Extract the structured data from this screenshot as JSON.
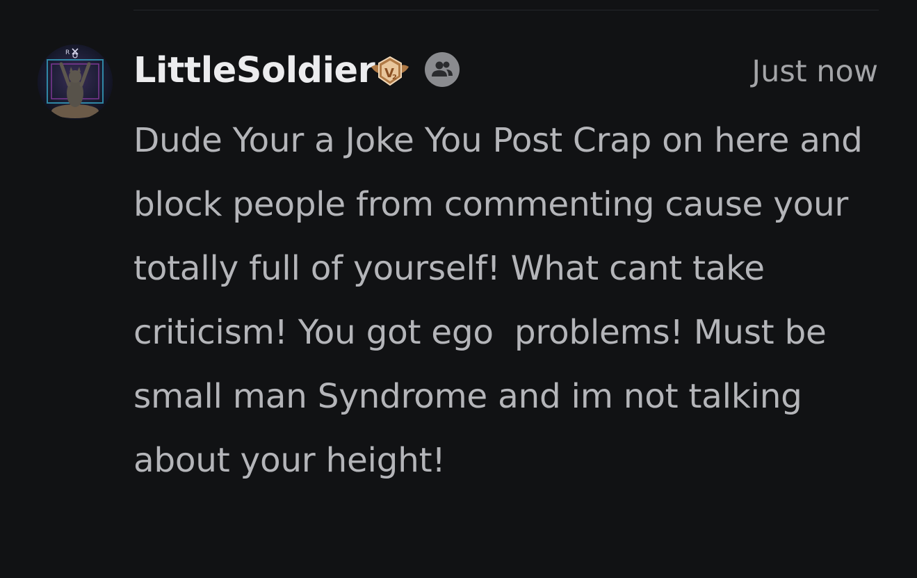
{
  "comment": {
    "author": "LittleSoldier",
    "level_badge_text": "V2",
    "badge_icons": [
      "level-badge-icon",
      "group-members-icon"
    ],
    "timestamp": "Just now",
    "body": "Dude Your a Joke You Post Crap on here and block people from commenting cause your totally full of yourself! What cant take criticism! You got ego  problems! Must be small man Syndrome and im not talking about your height!",
    "avatar_logo_text": "R"
  },
  "colors": {
    "background": "#111214",
    "username": "#ececee",
    "body_text": "#b4b5b9",
    "timestamp": "#a4a5a8",
    "level_badge": "#b07a46",
    "group_badge": "#8a8b8f"
  }
}
